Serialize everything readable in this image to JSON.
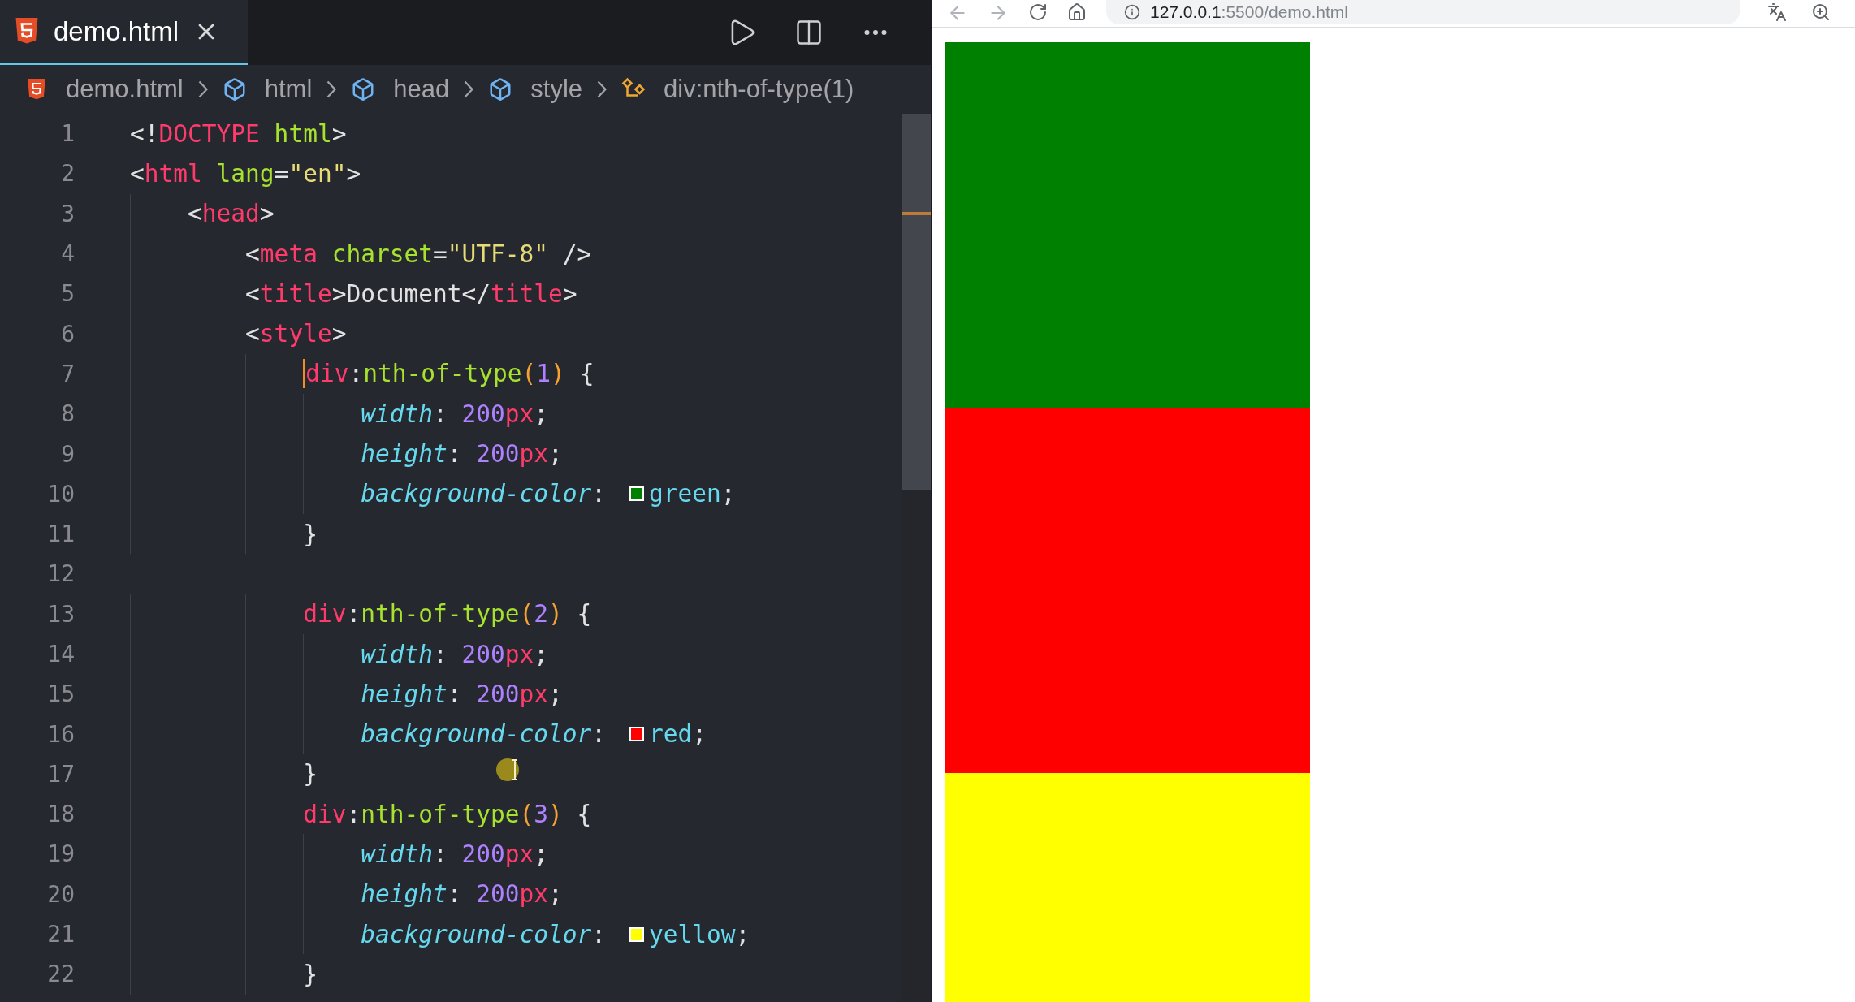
{
  "editor": {
    "tabs": [
      {
        "label": "demo.html",
        "selected": true
      }
    ],
    "breadcrumb": [
      {
        "kind": "file",
        "label": "demo.html"
      },
      {
        "kind": "element",
        "label": "html"
      },
      {
        "kind": "element",
        "label": "head"
      },
      {
        "kind": "element",
        "label": "style"
      },
      {
        "kind": "selector",
        "label": "div:nth-of-type(1)"
      }
    ],
    "lines": [
      {
        "number": "1",
        "cursor": false,
        "tokens": [
          {
            "kind": "punct",
            "text": "<!"
          },
          {
            "kind": "tag",
            "text": "DOCTYPE"
          },
          {
            "kind": "attr",
            "text": " html"
          },
          {
            "kind": "punct",
            "text": ">"
          }
        ]
      },
      {
        "number": "2",
        "cursor": false,
        "tokens": [
          {
            "kind": "punct",
            "text": "<"
          },
          {
            "kind": "tag",
            "text": "html"
          },
          {
            "kind": "attr",
            "text": " lang"
          },
          {
            "kind": "punct",
            "text": "="
          },
          {
            "kind": "string",
            "text": "\"en\""
          },
          {
            "kind": "punct",
            "text": ">"
          }
        ]
      },
      {
        "number": "3",
        "cursor": false,
        "tokens": [
          {
            "kind": "punct",
            "text": "    <"
          },
          {
            "kind": "tag",
            "text": "head"
          },
          {
            "kind": "punct",
            "text": ">"
          }
        ]
      },
      {
        "number": "4",
        "cursor": false,
        "tokens": [
          {
            "kind": "punct",
            "text": "        <"
          },
          {
            "kind": "tag",
            "text": "meta"
          },
          {
            "kind": "attr",
            "text": " charset"
          },
          {
            "kind": "punct",
            "text": "="
          },
          {
            "kind": "string",
            "text": "\"UTF-8\""
          },
          {
            "kind": "punct",
            "text": " />"
          }
        ]
      },
      {
        "number": "5",
        "cursor": false,
        "tokens": [
          {
            "kind": "punct",
            "text": "        <"
          },
          {
            "kind": "tag",
            "text": "title"
          },
          {
            "kind": "punct",
            "text": ">Document</"
          },
          {
            "kind": "tag",
            "text": "title"
          },
          {
            "kind": "punct",
            "text": ">"
          }
        ]
      },
      {
        "number": "6",
        "cursor": false,
        "tokens": [
          {
            "kind": "punct",
            "text": "        <"
          },
          {
            "kind": "tag",
            "text": "style"
          },
          {
            "kind": "punct",
            "text": ">"
          }
        ]
      },
      {
        "number": "7",
        "cursor": true,
        "tokens": [
          {
            "kind": "selector",
            "text": "            div"
          },
          {
            "kind": "punct",
            "text": ":"
          },
          {
            "kind": "function",
            "text": "nth-of-type"
          },
          {
            "kind": "paren",
            "text": "("
          },
          {
            "kind": "number",
            "text": "1"
          },
          {
            "kind": "paren",
            "text": ")"
          },
          {
            "kind": "punct",
            "text": " {"
          }
        ]
      },
      {
        "number": "8",
        "cursor": false,
        "tokens": [
          {
            "kind": "property",
            "text": "                width"
          },
          {
            "kind": "punct",
            "text": ": "
          },
          {
            "kind": "number",
            "text": "200"
          },
          {
            "kind": "unit",
            "text": "px"
          },
          {
            "kind": "punct",
            "text": ";"
          }
        ]
      },
      {
        "number": "9",
        "cursor": false,
        "tokens": [
          {
            "kind": "property",
            "text": "                height"
          },
          {
            "kind": "punct",
            "text": ": "
          },
          {
            "kind": "number",
            "text": "200"
          },
          {
            "kind": "unit",
            "text": "px"
          },
          {
            "kind": "punct",
            "text": ";"
          }
        ]
      },
      {
        "number": "10",
        "cursor": false,
        "tokens": [
          {
            "kind": "property",
            "text": "                background-color"
          },
          {
            "kind": "punct",
            "text": ": "
          },
          {
            "kind": "swatch",
            "color": "#008000"
          },
          {
            "kind": "value",
            "text": "green"
          },
          {
            "kind": "punct",
            "text": ";"
          }
        ]
      },
      {
        "number": "11",
        "cursor": false,
        "tokens": [
          {
            "kind": "punct",
            "text": "            }"
          }
        ]
      },
      {
        "number": "12",
        "cursor": false
      },
      {
        "number": "13",
        "cursor": false,
        "tokens": [
          {
            "kind": "selector",
            "text": "            div"
          },
          {
            "kind": "punct",
            "text": ":"
          },
          {
            "kind": "function",
            "text": "nth-of-type"
          },
          {
            "kind": "paren",
            "text": "("
          },
          {
            "kind": "number",
            "text": "2"
          },
          {
            "kind": "paren",
            "text": ")"
          },
          {
            "kind": "punct",
            "text": " {"
          }
        ]
      },
      {
        "number": "14",
        "cursor": false,
        "tokens": [
          {
            "kind": "property",
            "text": "                width"
          },
          {
            "kind": "punct",
            "text": ": "
          },
          {
            "kind": "number",
            "text": "200"
          },
          {
            "kind": "unit",
            "text": "px"
          },
          {
            "kind": "punct",
            "text": ";"
          }
        ]
      },
      {
        "number": "15",
        "cursor": false,
        "tokens": [
          {
            "kind": "property",
            "text": "                height"
          },
          {
            "kind": "punct",
            "text": ": "
          },
          {
            "kind": "number",
            "text": "200"
          },
          {
            "kind": "unit",
            "text": "px"
          },
          {
            "kind": "punct",
            "text": ";"
          }
        ]
      },
      {
        "number": "16",
        "cursor": false,
        "tokens": [
          {
            "kind": "property",
            "text": "                background-color"
          },
          {
            "kind": "punct",
            "text": ": "
          },
          {
            "kind": "swatch",
            "color": "#ff0000"
          },
          {
            "kind": "value",
            "text": "red"
          },
          {
            "kind": "punct",
            "text": ";"
          }
        ]
      },
      {
        "number": "17",
        "cursor": false,
        "tokens": [
          {
            "kind": "punct",
            "text": "            }"
          }
        ]
      },
      {
        "number": "18",
        "cursor": false,
        "tokens": [
          {
            "kind": "selector",
            "text": "            div"
          },
          {
            "kind": "punct",
            "text": ":"
          },
          {
            "kind": "function",
            "text": "nth-of-type"
          },
          {
            "kind": "paren",
            "text": "("
          },
          {
            "kind": "number",
            "text": "3"
          },
          {
            "kind": "paren",
            "text": ")"
          },
          {
            "kind": "punct",
            "text": " {"
          }
        ]
      },
      {
        "number": "19",
        "cursor": false,
        "tokens": [
          {
            "kind": "property",
            "text": "                width"
          },
          {
            "kind": "punct",
            "text": ": "
          },
          {
            "kind": "number",
            "text": "200"
          },
          {
            "kind": "unit",
            "text": "px"
          },
          {
            "kind": "punct",
            "text": ";"
          }
        ]
      },
      {
        "number": "20",
        "cursor": false,
        "tokens": [
          {
            "kind": "property",
            "text": "                height"
          },
          {
            "kind": "punct",
            "text": ": "
          },
          {
            "kind": "number",
            "text": "200"
          },
          {
            "kind": "unit",
            "text": "px"
          },
          {
            "kind": "punct",
            "text": ";"
          }
        ]
      },
      {
        "number": "21",
        "cursor": false,
        "tokens": [
          {
            "kind": "property",
            "text": "                background-color"
          },
          {
            "kind": "punct",
            "text": ": "
          },
          {
            "kind": "swatch",
            "color": "#ffff00"
          },
          {
            "kind": "value",
            "text": "yellow"
          },
          {
            "kind": "punct",
            "text": ";"
          }
        ]
      },
      {
        "number": "22",
        "cursor": false,
        "tokens": [
          {
            "kind": "punct",
            "text": "            }"
          }
        ]
      }
    ]
  },
  "browser": {
    "url_host": "127.0.0.1",
    "url_rest": ":5500/demo.html",
    "boxes": [
      {
        "color": "#008000"
      },
      {
        "color": "#ff0000"
      },
      {
        "color": "#ffff00"
      }
    ]
  }
}
